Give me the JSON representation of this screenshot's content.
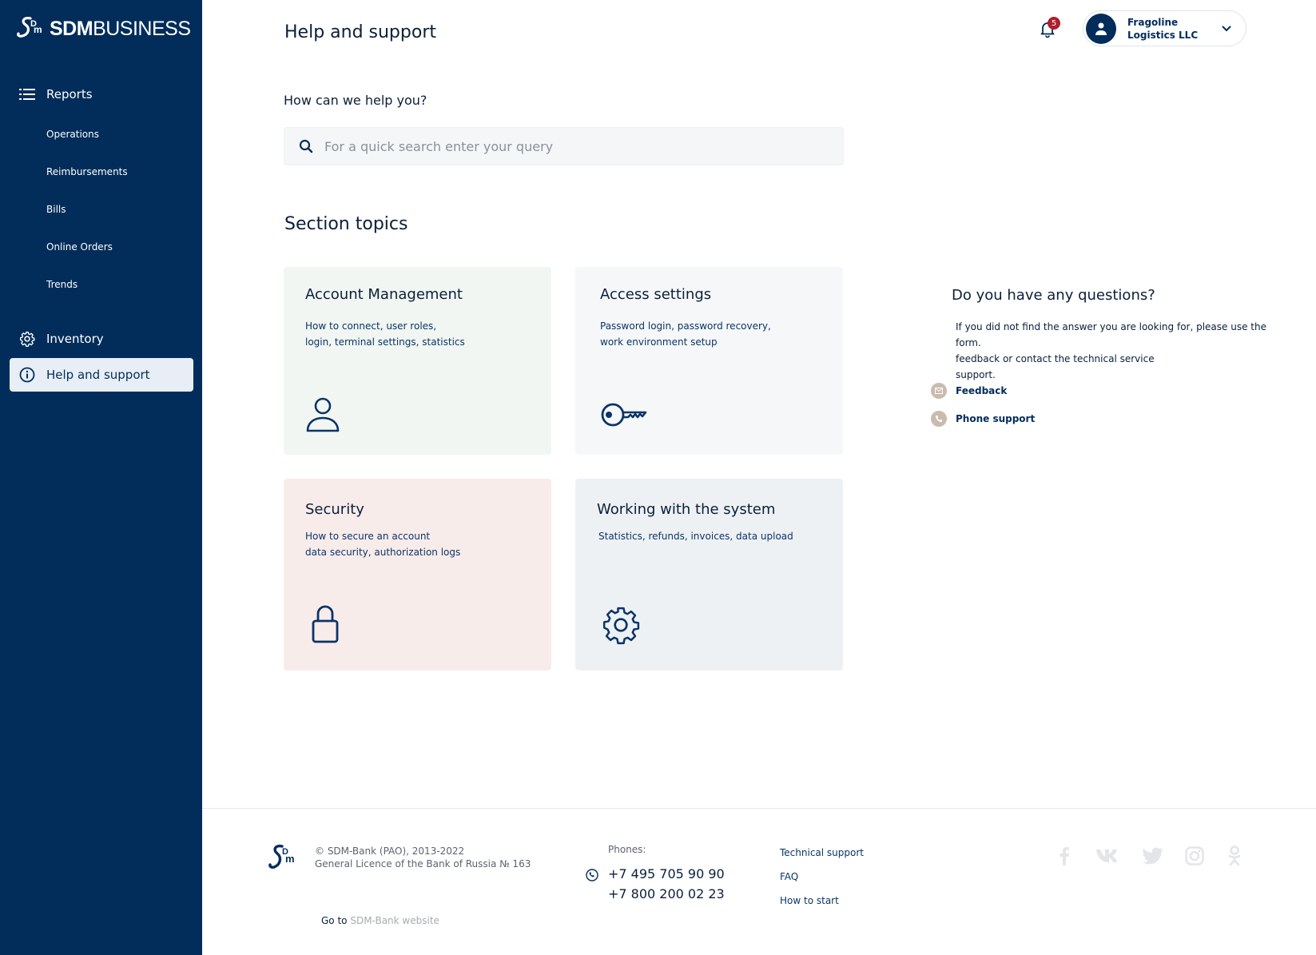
{
  "brand": {
    "logo_bold": "SDM",
    "logo_regular": "BUSINESS"
  },
  "sidebar": {
    "reports_label": "Reports",
    "sub_items": [
      "Operations",
      "Reimbursements",
      "Bills",
      "Online Orders",
      "Trends"
    ],
    "inventory_label": "Inventory",
    "help_label": "Help and support"
  },
  "header": {
    "title": "Help and support",
    "notification_count": "5",
    "account_name_line1": "Fragoline",
    "account_name_line2": "Logistics LLC"
  },
  "help": {
    "question": "How can we help you?",
    "search_placeholder": "For a quick search enter your query"
  },
  "topics": {
    "title": "Section topics",
    "cards": [
      {
        "title": "Account Management",
        "desc_line1": "How to connect, user roles,",
        "desc_line2": "login, terminal settings, statistics",
        "icon": "user-icon",
        "bg": "#f1f6f2"
      },
      {
        "title": "Access settings",
        "desc_line1": "Password login, password recovery,",
        "desc_line2": "work environment setup",
        "icon": "key-icon",
        "bg": "#f6f7f9"
      },
      {
        "title": "Security",
        "desc_line1": "How to secure an account",
        "desc_line2": "data security, authorization logs",
        "icon": "lock-icon",
        "bg": "#f8eceb"
      },
      {
        "title": "Working with the system",
        "desc_line1": "Statistics, refunds, invoices, data upload",
        "desc_line2": "",
        "icon": "gear-icon",
        "bg": "#eef1f4"
      }
    ]
  },
  "questions": {
    "title": "Do you have any questions?",
    "text_line1": "If you did not find the answer you are looking for, please use the form.",
    "text_line2": "feedback or contact the technical service",
    "text_line3": "support.",
    "feedback_label": "Feedback",
    "phone_support_label": "Phone support"
  },
  "footer": {
    "copyright_line1": "© SDM-Bank (PAO), 2013-2022",
    "copyright_line2": "General Licence of the Bank of Russia № 163",
    "goto_prefix": "Go to",
    "goto_link": "SDM-Bank website",
    "phones_label": "Phones:",
    "phone1": "+7 495 705 90 90",
    "phone2": "+7 800 200 02 23",
    "links": [
      "Technical support",
      "FAQ",
      "How to start"
    ],
    "social_icons": [
      "facebook-icon",
      "vk-icon",
      "twitter-icon",
      "instagram-icon",
      "odnoklassniki-icon"
    ]
  },
  "colors": {
    "sidebar": "#022d5a",
    "accent": "#022d5a",
    "badge": "#b01e2d",
    "contact_dot": "#c9bcae"
  }
}
